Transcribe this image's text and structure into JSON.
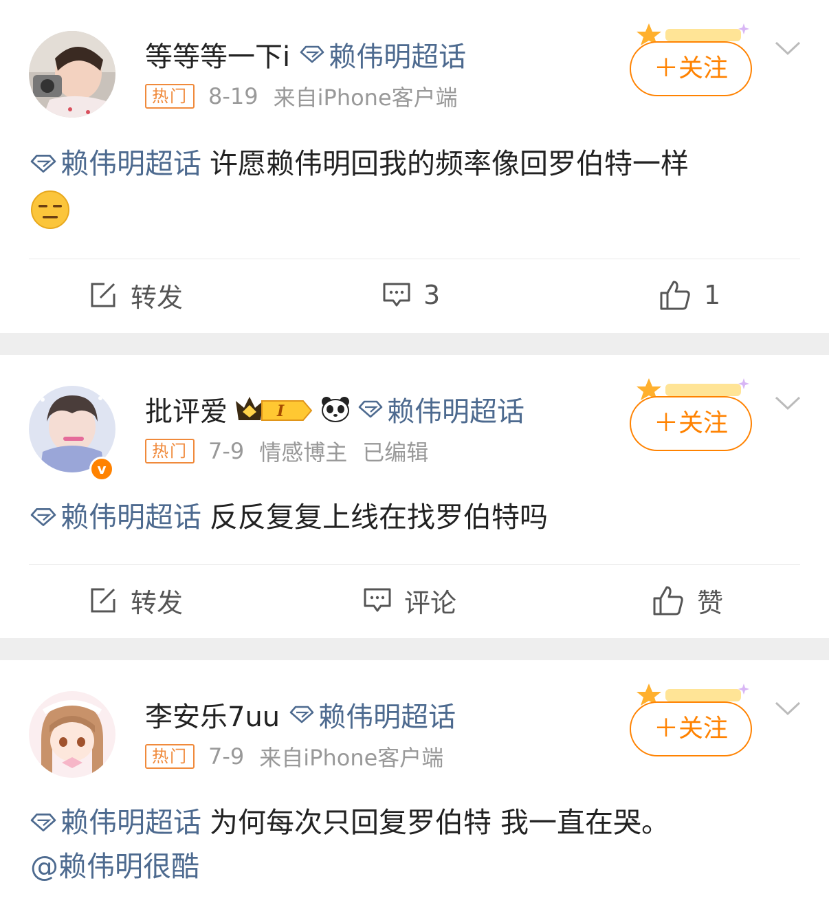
{
  "posts": [
    {
      "username": "等等等一下i",
      "topic": "赖伟明超话",
      "hot_tag": "热门",
      "time": "8-19",
      "extra": "",
      "source": "来自iPhone客户端",
      "follow_label": "＋关注",
      "content_topic": "赖伟明超话",
      "content_text": "许愿赖伟明回我的频率像回罗伯特一样",
      "emoji": "expressionless-face",
      "repost_label": "转发",
      "comment_label": "3",
      "like_label": "1"
    },
    {
      "username": "批评爱",
      "badge_level": "I",
      "topic": "赖伟明超话",
      "hot_tag": "热门",
      "time": "7-9",
      "extra": "情感博主",
      "source": "已编辑",
      "follow_label": "＋关注",
      "content_topic": "赖伟明超话",
      "content_text": "反反复复上线在找罗伯特吗",
      "repost_label": "转发",
      "comment_label": "评论",
      "like_label": "赞"
    },
    {
      "username": "李安乐7uu",
      "topic": "赖伟明超话",
      "hot_tag": "热门",
      "time": "7-9",
      "extra": "",
      "source": "来自iPhone客户端",
      "follow_label": "＋关注",
      "content_topic": "赖伟明超话",
      "content_text": "为何每次只回复罗伯特 我一直在哭。",
      "mention": "@赖伟明很酷"
    }
  ],
  "colors": {
    "accent_orange": "#ff8200",
    "link_blue": "#4d6a8f",
    "divider_gray": "#eeeeee"
  }
}
